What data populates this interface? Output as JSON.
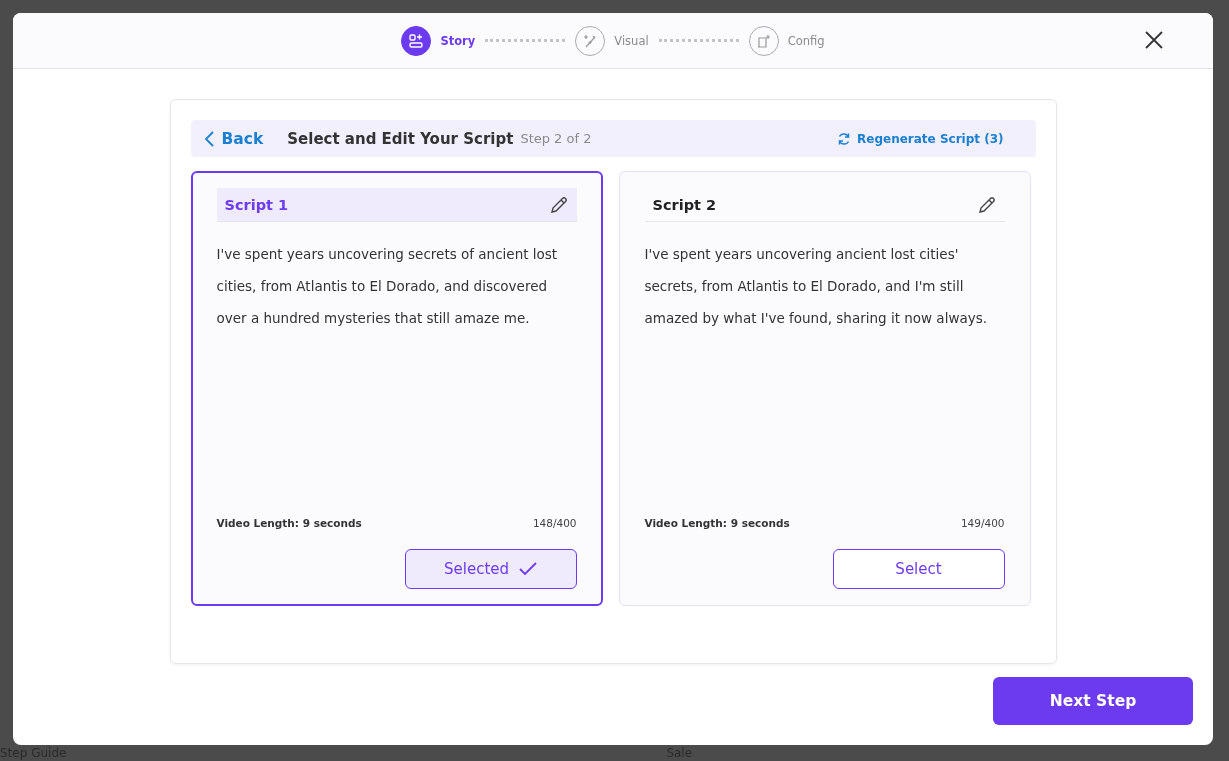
{
  "background": {
    "texts": [
      "Step Guide",
      "Sale"
    ]
  },
  "stepper": {
    "steps": [
      {
        "label": "Story",
        "selected": true
      },
      {
        "label": "Visual",
        "selected": false
      },
      {
        "label": "Config",
        "selected": false
      }
    ]
  },
  "toolbar": {
    "back": "Back",
    "title": "Select and Edit Your Script",
    "step": "Step 2 of 2",
    "regenerate": "Regenerate Script (3)"
  },
  "scripts": [
    {
      "title": "Script 1",
      "text": "I've spent years uncovering secrets of ancient lost cities, from Atlantis to El Dorado, and discovered over a hundred mysteries that still amaze me.",
      "length": "Video Length: 9 seconds",
      "count": "148/400",
      "button": "Selected",
      "selected": true
    },
    {
      "title": "Script 2",
      "text": "I've spent years uncovering ancient lost cities' secrets, from Atlantis to El Dorado, and I'm still amazed by what I've found, sharing it now always.",
      "length": "Video Length: 9 seconds",
      "count": "149/400",
      "button": "Select",
      "selected": false
    }
  ],
  "next_button": "Next Step"
}
